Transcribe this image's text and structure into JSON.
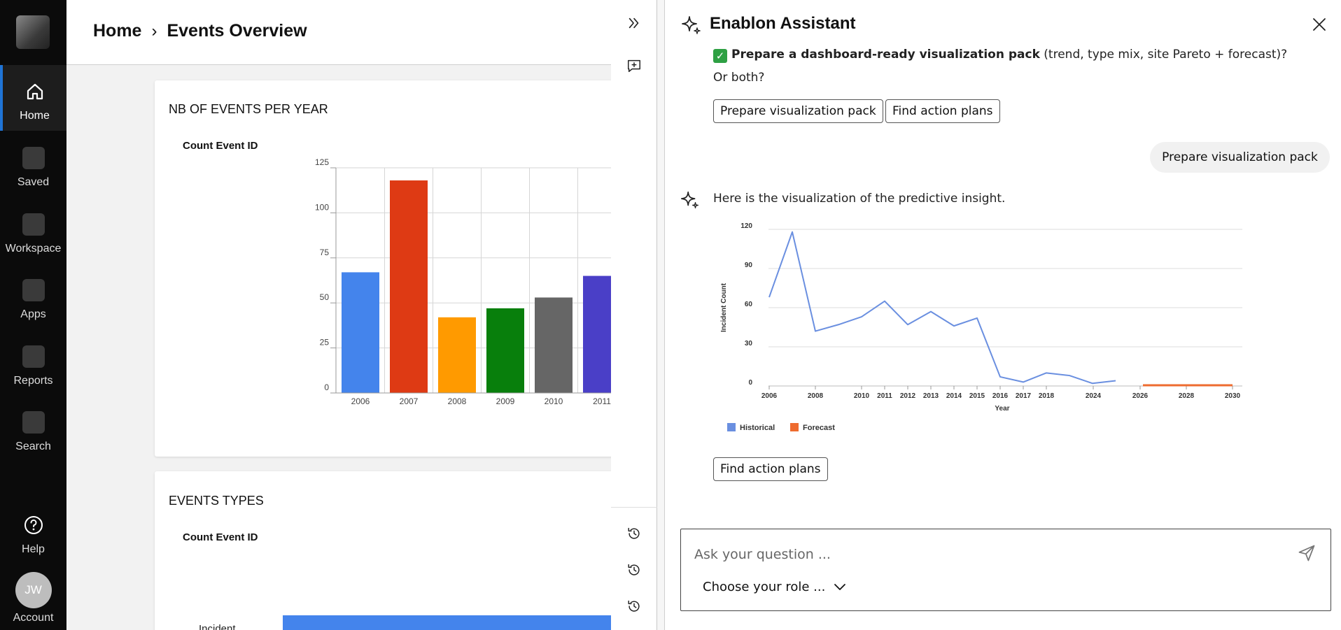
{
  "rail": {
    "items": [
      {
        "label": "Home"
      },
      {
        "label": "Saved"
      },
      {
        "label": "Workspace"
      },
      {
        "label": "Apps"
      },
      {
        "label": "Reports"
      },
      {
        "label": "Search"
      }
    ],
    "help_label": "Help",
    "account_label": "Account",
    "account_initials": "JW"
  },
  "header": {
    "crumb_home": "Home",
    "crumb_separator": "›",
    "crumb_current": "Events Overview"
  },
  "cards": {
    "events_per_year": {
      "title": "NB OF EVENTS PER YEAR",
      "measure": "Count Event ID"
    },
    "events_types": {
      "title": "EVENTS TYPES",
      "measure": "Count Event ID",
      "first_row_label": "Incident"
    }
  },
  "assistant": {
    "title": "Enablon Assistant",
    "messages": {
      "pack_bold": "Prepare a dashboard-ready visualization pack",
      "pack_rest": " (trend, type mix, site Pareto + forecast)?",
      "or_both": "Or both?",
      "chip_visualization": "Prepare visualization pack",
      "chip_action_plans": "Find action plans",
      "user_message": "Prepare visualization pack",
      "bot_intro": "Here is the visualization of the predictive insight.",
      "chip_action_plans_2": "Find action plans"
    },
    "input": {
      "placeholder": "Ask your question ...",
      "role_label": "Choose your role ..."
    }
  },
  "colors": {
    "accent": "#1f74d6",
    "historical": "#6a8fe0",
    "forecast": "#ee6b2f"
  },
  "chart_data": [
    {
      "type": "bar",
      "title": "NB OF EVENTS PER YEAR",
      "ylabel": "Count Event ID",
      "categories": [
        "2006",
        "2007",
        "2008",
        "2009",
        "2010",
        "2011"
      ],
      "values": [
        67,
        118,
        42,
        47,
        53,
        65
      ],
      "colors": [
        "#4484ec",
        "#de3a14",
        "#ff9a00",
        "#087f0c",
        "#666666",
        "#4a3fc7"
      ],
      "ylim": [
        0,
        125
      ],
      "yticks": [
        0,
        25,
        50,
        75,
        100,
        125
      ],
      "grid": true
    },
    {
      "type": "bar",
      "title": "EVENTS TYPES",
      "ylabel": "Count Event ID",
      "orientation": "horizontal",
      "categories": [
        "Incident"
      ],
      "color": "#4484ec"
    },
    {
      "type": "line",
      "xlabel": "Year",
      "ylabel": "Incident Count",
      "ylim": [
        0,
        120
      ],
      "yticks": [
        0,
        30,
        60,
        90,
        120
      ],
      "xlim": [
        2006,
        2030
      ],
      "xticks": [
        "2006",
        "2008",
        "2010",
        "2011",
        "2012",
        "2013",
        "2014",
        "2015",
        "2016",
        "2017",
        "2018",
        "2024",
        "2026",
        "2028",
        "2030"
      ],
      "legend": "bottom-left",
      "grid": true,
      "series": [
        {
          "name": "Historical",
          "color": "#6a8fe0",
          "points": [
            [
              2006,
              68
            ],
            [
              2007,
              118
            ],
            [
              2008,
              42
            ],
            [
              2009,
              47
            ],
            [
              2010,
              53
            ],
            [
              2011,
              65
            ],
            [
              2012,
              47
            ],
            [
              2013,
              57
            ],
            [
              2014,
              46
            ],
            [
              2015,
              52
            ],
            [
              2016,
              7
            ],
            [
              2017,
              3
            ],
            [
              2018,
              10
            ],
            [
              2019,
              8
            ],
            [
              2020,
              2
            ],
            [
              2021,
              4
            ]
          ]
        },
        {
          "name": "Forecast",
          "color": "#ee6b2f",
          "points": [
            [
              2022,
              0
            ],
            [
              2023,
              0
            ],
            [
              2024,
              0
            ],
            [
              2025,
              0
            ],
            [
              2026,
              0
            ]
          ]
        }
      ]
    }
  ]
}
